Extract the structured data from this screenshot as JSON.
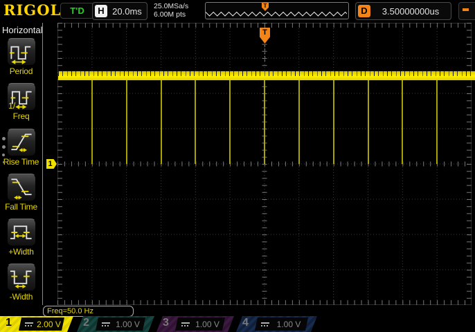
{
  "top_bar": {
    "logo": "RIGOL",
    "trigger_status": "T'D",
    "h_label": "H",
    "timebase": "20.0ms",
    "sample_rate": "25.0MSa/s",
    "mem_depth": "6.00M pts",
    "d_label": "D",
    "delay": "3.50000000us"
  },
  "menu": {
    "title": "Horizontal",
    "items": [
      {
        "label": "Period",
        "icon": "period-icon"
      },
      {
        "label": "Freq",
        "icon": "freq-icon"
      },
      {
        "label": "Rise Time",
        "icon": "rise-time-icon"
      },
      {
        "label": "Fall Time",
        "icon": "fall-time-icon"
      },
      {
        "label": "+Width",
        "icon": "pos-width-icon"
      },
      {
        "label": "-Width",
        "icon": "neg-width-icon"
      }
    ]
  },
  "graticule": {
    "measurement_label": "Freq=50.0 Hz",
    "trigger_marker": "T",
    "channel_marker": "1",
    "h_divisions": 12,
    "v_divisions": 8
  },
  "waveform": {
    "signal": "CH1 pulse train",
    "frequency_hz": 50,
    "high_level_divisions": 2.5,
    "low_level_divisions": 0,
    "period_divisions": 1,
    "pulse_count": 11,
    "color": "#f0e000"
  },
  "channels": [
    {
      "num": "1",
      "volts": "2.00 V",
      "active": true,
      "color": "#f0e000"
    },
    {
      "num": "2",
      "volts": "1.00 V",
      "active": false,
      "color": "#1a4a44"
    },
    {
      "num": "3",
      "volts": "1.00 V",
      "active": false,
      "color": "#5a2a5e"
    },
    {
      "num": "4",
      "volts": "1.00 V",
      "active": false,
      "color": "#23406e"
    }
  ],
  "colors": {
    "accent_orange": "#f28418",
    "triggered_green": "#21d421",
    "logo_yellow": "#ffd400"
  }
}
